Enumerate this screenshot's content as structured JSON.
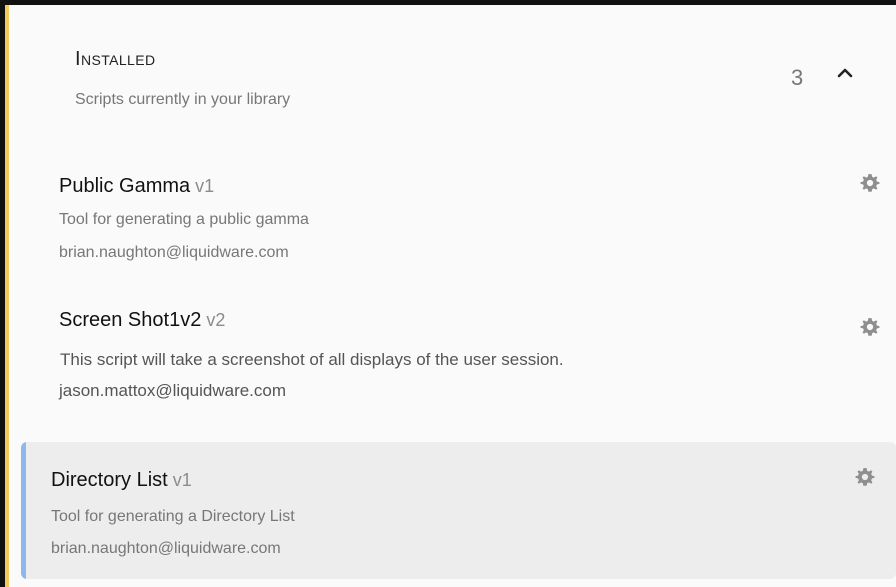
{
  "section": {
    "title": "Installed",
    "subtitle": "Scripts currently in your library",
    "count": "3"
  },
  "scripts": [
    {
      "name": "Public Gamma",
      "version": "v1",
      "description": "Tool for generating a public gamma",
      "author_email": "brian.naughton@liquidware.com"
    },
    {
      "name": "Screen Shot1v2",
      "version": "v2",
      "description": "This script will take a screenshot of all displays of the user session.",
      "author_email": "jason.mattox@liquidware.com"
    },
    {
      "name": "Directory List",
      "version": "v1",
      "description": "Tool for generating a Directory List",
      "author_email": "brian.naughton@liquidware.com"
    }
  ],
  "icons": {
    "collapse": "chevron-up-icon",
    "settings": "gear-icon"
  },
  "colors": {
    "selection_accent": "#8db8ef",
    "selected_background": "#ededed",
    "icon_gray": "#8f8f8f",
    "outer_border": "#111111",
    "left_accent": "#f2cb5c"
  }
}
